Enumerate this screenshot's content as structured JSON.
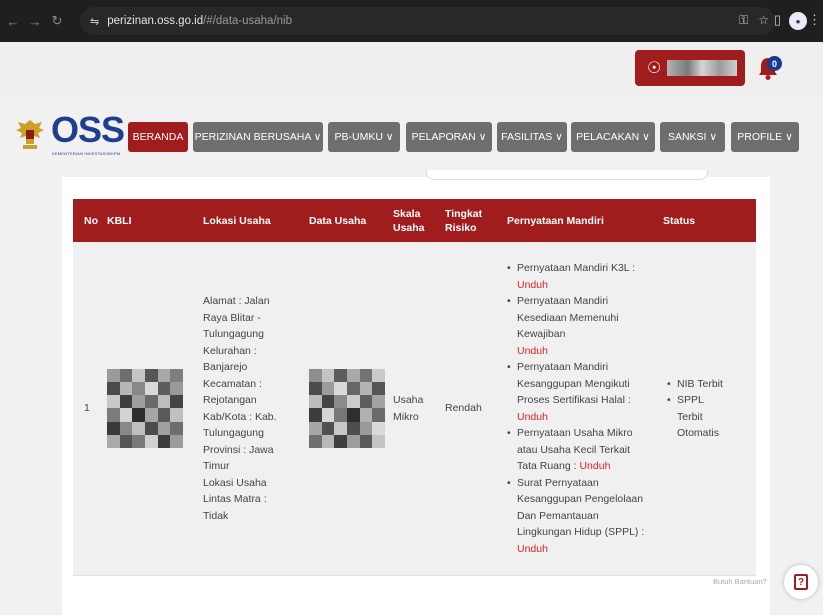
{
  "browser": {
    "url_host": "perizinan.oss.go.id",
    "url_path": "/#/data-usaha/nib"
  },
  "user": {
    "badge_count": "0"
  },
  "logo": {
    "text": "OSS",
    "subtitle": "KEMENTERIAN INVESTASI/BKPM"
  },
  "nav": [
    {
      "label": "BERANDA",
      "active": true
    },
    {
      "label": "PERIZINAN BERUSAHA ∨"
    },
    {
      "label": "PB-UMKU ∨"
    },
    {
      "label": "PELAPORAN ∨"
    },
    {
      "label": "FASILITAS ∨"
    },
    {
      "label": "PELACAKAN ∨"
    },
    {
      "label": "SANKSI ∨"
    },
    {
      "label": "PROFILE ∨"
    }
  ],
  "table": {
    "headers": {
      "no": "No",
      "kbli": "KBLI",
      "lokasi": "Lokasi Usaha",
      "data": "Data Usaha",
      "skala": "Skala Usaha",
      "risiko": "Tingkat Risiko",
      "pernyataan": "Pernyataan Mandiri",
      "status": "Status"
    },
    "row": {
      "no": "1",
      "lokasi": [
        "Alamat : Jalan",
        "Raya Blitar -",
        "Tulungagung",
        "Kelurahan :",
        "Banjarejo",
        "Kecamatan :",
        "Rejotangan",
        "Kab/Kota : Kab.",
        "Tulungagung",
        "Provinsi : Jawa",
        "Timur",
        "Lokasi Usaha",
        "Lintas Matra :",
        "Tidak"
      ],
      "skala": [
        "Usaha",
        "Mikro"
      ],
      "risiko": "Rendah",
      "pernyataan": [
        {
          "lines": [
            "Pernyataan Mandiri K3L :"
          ],
          "link": "Unduh",
          "inline": false
        },
        {
          "lines": [
            "Pernyataan Mandiri",
            "Kesediaan Memenuhi",
            "Kewajiban"
          ],
          "link": "Unduh",
          "inline": false
        },
        {
          "lines": [
            "Pernyataan Mandiri",
            "Kesanggupan Mengikuti",
            "Proses Sertifikasi Halal :"
          ],
          "link": "Unduh",
          "inline": false
        },
        {
          "lines": [
            "Pernyataan Usaha Mikro",
            "atau Usaha Kecil Terkait",
            "Tata Ruang : "
          ],
          "link": "Unduh",
          "inline": true
        },
        {
          "lines": [
            "Surat Pernyataan",
            "Kesanggupan Pengelolaan",
            "Dan Pemantauan",
            "Lingkungan Hidup (SPPL) :"
          ],
          "link": "Unduh",
          "inline": false
        }
      ],
      "status": [
        {
          "lines": [
            "NIB Terbit"
          ]
        },
        {
          "lines": [
            "SPPL",
            "Terbit",
            "Otomatis"
          ]
        }
      ]
    }
  },
  "help": {
    "label": "Butuh Bantuan?",
    "icon": "?"
  },
  "colors": {
    "brand_red": "#a11d1d",
    "nav_gray": "#6e6e6e",
    "link_red": "#e02424",
    "logo_blue": "#1e3f8f"
  }
}
